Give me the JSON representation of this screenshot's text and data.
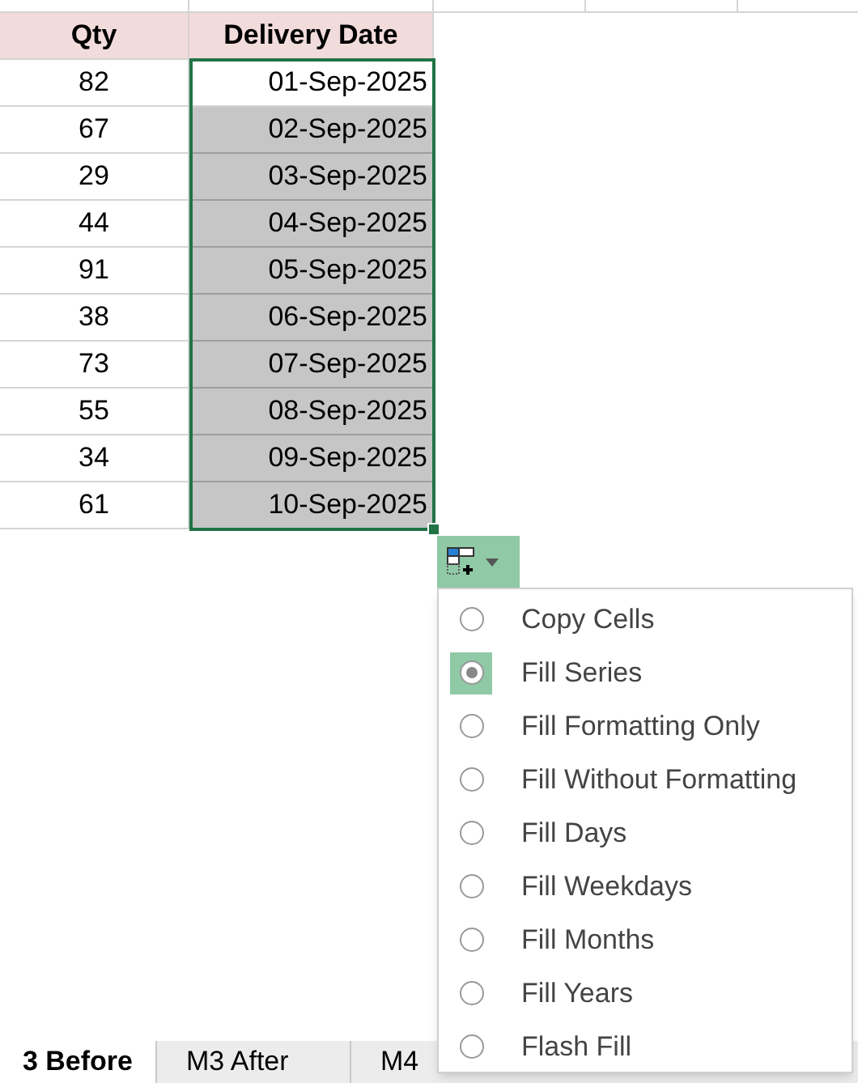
{
  "table": {
    "columns": [
      "Qty",
      "Delivery Date"
    ],
    "rows": [
      {
        "qty": "82",
        "date": "01-Sep-2025",
        "highlighted": false
      },
      {
        "qty": "67",
        "date": "02-Sep-2025",
        "highlighted": true
      },
      {
        "qty": "29",
        "date": "03-Sep-2025",
        "highlighted": true
      },
      {
        "qty": "44",
        "date": "04-Sep-2025",
        "highlighted": true
      },
      {
        "qty": "91",
        "date": "05-Sep-2025",
        "highlighted": true
      },
      {
        "qty": "38",
        "date": "06-Sep-2025",
        "highlighted": true
      },
      {
        "qty": "73",
        "date": "07-Sep-2025",
        "highlighted": true
      },
      {
        "qty": "55",
        "date": "08-Sep-2025",
        "highlighted": true
      },
      {
        "qty": "34",
        "date": "09-Sep-2025",
        "highlighted": true
      },
      {
        "qty": "61",
        "date": "10-Sep-2025",
        "highlighted": true
      }
    ]
  },
  "autofill_menu": {
    "items": [
      {
        "label": "Copy Cells",
        "selected": false
      },
      {
        "label": "Fill Series",
        "selected": true
      },
      {
        "label": "Fill Formatting Only",
        "selected": false
      },
      {
        "label": "Fill Without Formatting",
        "selected": false
      },
      {
        "label": "Fill Days",
        "selected": false
      },
      {
        "label": "Fill Weekdays",
        "selected": false
      },
      {
        "label": "Fill Months",
        "selected": false
      },
      {
        "label": "Fill Years",
        "selected": false
      },
      {
        "label": "Flash Fill",
        "selected": false
      }
    ]
  },
  "sheet_tabs": [
    {
      "label": "3 Before",
      "selected": true
    },
    {
      "label": "M3 After",
      "selected": false
    },
    {
      "label": "M4",
      "selected": false
    }
  ]
}
